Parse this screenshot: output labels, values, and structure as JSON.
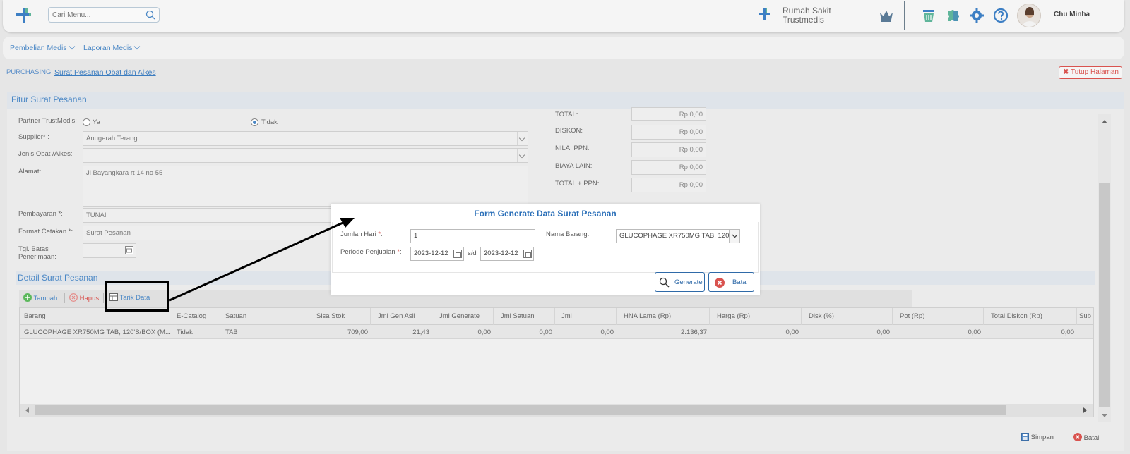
{
  "header": {
    "search_placeholder": "Cari Menu...",
    "hospital_name": "Rumah Sakit Trustmedis",
    "user_name": "Chu Minha"
  },
  "menu": {
    "items": [
      {
        "label": "Pembelian Medis"
      },
      {
        "label": "Laporan Medis"
      }
    ]
  },
  "breadcrumb": {
    "root": "PURCHASING",
    "current": "Surat Pesanan Obat dan Alkes"
  },
  "close_page_label": "Tutup Halaman",
  "form": {
    "title": "Fitur Surat Pesanan",
    "partner_label": "Partner TrustMedis:",
    "partner_options": [
      "Ya",
      "Tidak"
    ],
    "partner_selected": "Tidak",
    "supplier_label": "Supplier* :",
    "supplier_value": "Anugerah Terang",
    "jenis_label": "Jenis Obat /Alkes:",
    "jenis_value": "",
    "alamat_label": "Alamat:",
    "alamat_value": "Jl Bayangkara rt 14 no 55",
    "pembayaran_label": "Pembayaran *:",
    "pembayaran_value": "TUNAI",
    "format_label": "Format Cetakan *:",
    "format_value": "Surat Pesanan",
    "tgl_label": "Tgl. Batas Penerimaan:",
    "tgl_value": "",
    "totals": [
      {
        "label": "TOTAL:",
        "value": "Rp 0,00"
      },
      {
        "label": "DISKON:",
        "value": "Rp 0,00"
      },
      {
        "label": "NILAI PPN:",
        "value": "Rp 0,00"
      },
      {
        "label": "BIAYA LAIN:",
        "value": "Rp 0,00"
      },
      {
        "label": "TOTAL + PPN:",
        "value": "Rp 0,00"
      }
    ]
  },
  "detail": {
    "title": "Detail Surat Pesanan",
    "toolbar": {
      "add": "Tambah",
      "delete": "Hapus",
      "pull": "Tarik Data"
    },
    "columns": [
      "Barang",
      "E-Catalog",
      "Satuan",
      "Sisa Stok",
      "Jml Gen Asli",
      "Jml Generate",
      "Jml Satuan",
      "Jml",
      "HNA Lama (Rp)",
      "Harga (Rp)",
      "Disk (%)",
      "Pot (Rp)",
      "Total Diskon (Rp)",
      "Sub"
    ],
    "rows": [
      [
        "GLUCOPHAGE XR750MG TAB, 120'S/BOX (M...",
        "Tidak",
        "TAB",
        "709,00",
        "21,43",
        "0,00",
        "0,00",
        "0,00",
        "2.136,37",
        "0,00",
        "0,00",
        "0,00",
        "0,00",
        ""
      ]
    ]
  },
  "footer": {
    "save": "Simpan",
    "cancel": "Batal"
  },
  "modal": {
    "title": "Form Generate Data Surat Pesanan",
    "jumlah_hari_label": "Jumlah Hari",
    "jumlah_hari_value": "1",
    "periode_label": "Periode Penjualan",
    "date_from": "2023-12-12",
    "date_sep": "s/d",
    "date_to": "2023-12-12",
    "nama_barang_label": "Nama Barang:",
    "nama_barang_value": "GLUCOPHAGE XR750MG TAB, 120'",
    "generate_label": "Generate",
    "cancel_label": "Batal",
    "required_mark": "*",
    "colon": ":"
  },
  "colors": {
    "accent": "#4a87c5",
    "danger": "#d9534f",
    "logo_green": "#5fb59a",
    "logo_blue": "#3d7fc4"
  }
}
